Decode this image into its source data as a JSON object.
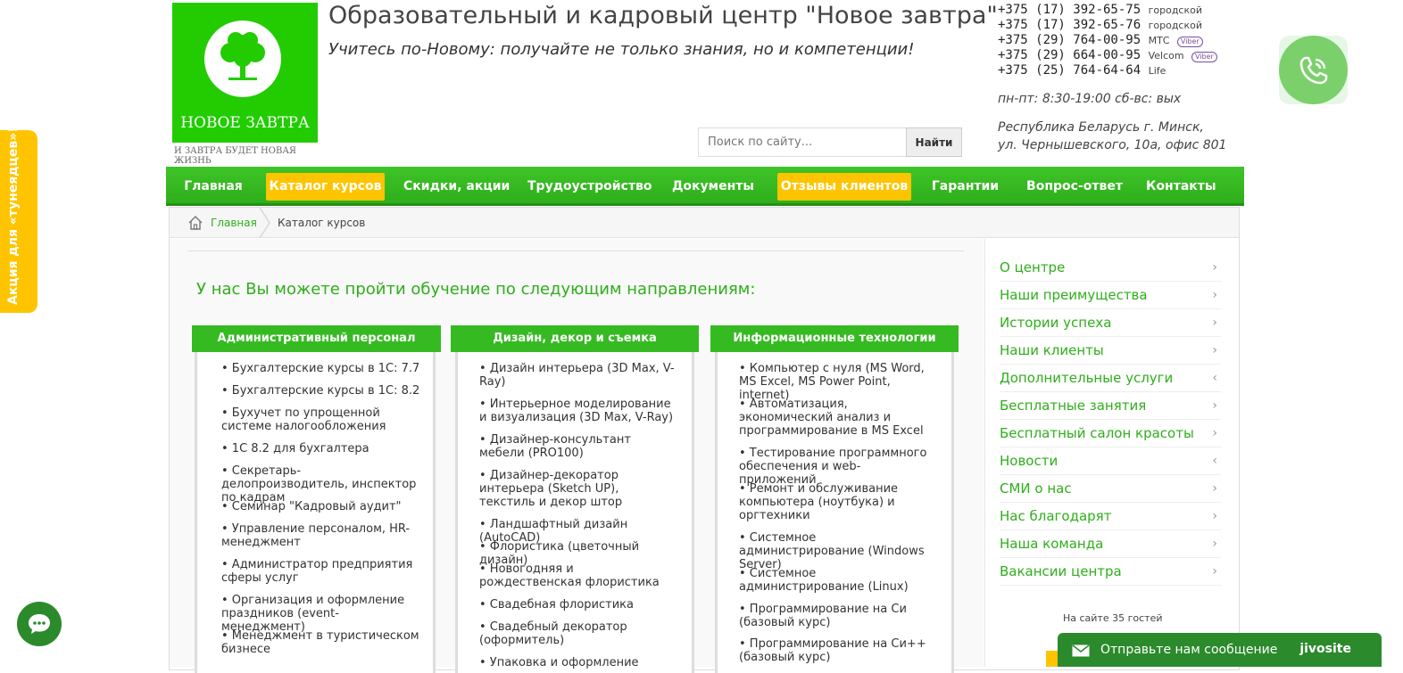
{
  "header": {
    "logo_text": "НОВОЕ ЗАВТРА",
    "logo_slogan": "И ЗАВТРА БУДЕТ НОВАЯ ЖИЗНЬ",
    "title": "Образовательный и кадровый центр \"Новое завтра\"",
    "tagline": "Учитесь по-Новому: получайте не только знания, но и компетенции!",
    "search_placeholder": "Поиск по сайту...",
    "search_button": "Найти",
    "phones": [
      {
        "number": "+375 (17) 392-65-75",
        "operator": "городской",
        "viber": ""
      },
      {
        "number": "+375 (17) 392-65-76",
        "operator": "городской",
        "viber": ""
      },
      {
        "number": "+375 (29) 764-00-95",
        "operator": "МТС",
        "viber": "Viber"
      },
      {
        "number": "+375 (29) 664-00-95",
        "operator": "Velcom",
        "viber": "Viber"
      },
      {
        "number": "+375 (25) 764-64-64",
        "operator": "Life",
        "viber": ""
      }
    ],
    "hours": "пн-пт: 8:30-19:00 сб-вс: вых",
    "address_line1": "Республика Беларусь г. Минск,",
    "address_line2": "ул. Чернышевского, 10а, офис 801"
  },
  "nav": {
    "items": [
      {
        "label": "Главная"
      },
      {
        "label": "Каталог курсов"
      },
      {
        "label": "Скидки, акции"
      },
      {
        "label": "Трудоустройство"
      },
      {
        "label": "Документы"
      },
      {
        "label": "Отзывы клиентов"
      },
      {
        "label": "Гарантии"
      },
      {
        "label": "Вопрос-ответ"
      },
      {
        "label": "Контакты"
      }
    ]
  },
  "side_badge": "Акция для «тунеядцев»!",
  "breadcrumbs": {
    "home": "Главная",
    "current": "Каталог курсов"
  },
  "main": {
    "intro": "У нас Вы можете пройти обучение по следующим направлениям:",
    "columns": [
      {
        "title": "Административный персонал",
        "items": [
          "• Бухгалтерские курсы в 1С: 7.7",
          "• Бухгалтерские курсы в 1С: 8.2",
          "• Бухучет по упрощенной системе налогообложения",
          "• 1С 8.2 для бухгалтера",
          "• Секретарь-делопроизводитель, инспектор по кадрам",
          "• Семинар \"Кадровый аудит\"",
          "• Управление персоналом, HR-менеджмент",
          "• Администратор предприятия сферы услуг",
          "• Организация и оформление праздников (event-менеджмент)",
          "• Менеджмент в туристическом бизнесе"
        ]
      },
      {
        "title": "Дизайн, декор и съемка",
        "items": [
          "• Дизайн интерьера (3D Max, V-Ray)",
          "• Интерьерное моделирование и визуализация (3D Max, V-Ray)",
          "• Дизайнер-консультант мебели (PRO100)",
          "• Дизайнер-декоратор интерьера (Sketch UP), текстиль и декор штор",
          "• Ландшафтный дизайн (AutoCAD)",
          "• Флористика (цветочный дизайн)",
          "• Новогодняя и рождественская флористика",
          "• Свадебная флористика",
          "• Свадебный декоратор (оформитель)",
          "• Упаковка и оформление"
        ]
      },
      {
        "title": "Информационные технологии",
        "items": [
          "• Компьютер с нуля (MS Word, MS Excel, MS Power Point, internet)",
          "• Автоматизация, экономический анализ и программирование в MS Excel",
          "• Тестирование программного обеспечения и web-приложений",
          "• Ремонт и обслуживание компьютера (ноутбука) и оргтехники",
          "• Системное администрирование (Windows Server)",
          "• Системное администрирование (Linux)",
          "• Программирование на Си (базовый курс)",
          "• Программирование на Си++ (базовый курс)"
        ]
      }
    ]
  },
  "sidebar": {
    "links": [
      {
        "label": "О центре",
        "chev": "›"
      },
      {
        "label": "Наши преимущества",
        "chev": "›"
      },
      {
        "label": "Истории успеха",
        "chev": "›"
      },
      {
        "label": "Наши клиенты",
        "chev": "›"
      },
      {
        "label": "Дополнительные услуги",
        "chev": "‹"
      },
      {
        "label": "Бесплатные занятия",
        "chev": "›"
      },
      {
        "label": "Бесплатный салон красоты",
        "chev": "›"
      },
      {
        "label": "Новости",
        "chev": "‹"
      },
      {
        "label": "СМИ о нас",
        "chev": "›"
      },
      {
        "label": "Нас благодарят",
        "chev": "›"
      },
      {
        "label": "Наша команда",
        "chev": "›"
      },
      {
        "label": "Вакансии центра",
        "chev": "›"
      }
    ],
    "guests": "На сайте 35 гостей"
  },
  "chat": {
    "label": "Отправьте нам сообщение",
    "brand": "jivosite"
  },
  "colors": {
    "brand_green": "#2fae1b",
    "accent_yellow": "#ffc400"
  }
}
